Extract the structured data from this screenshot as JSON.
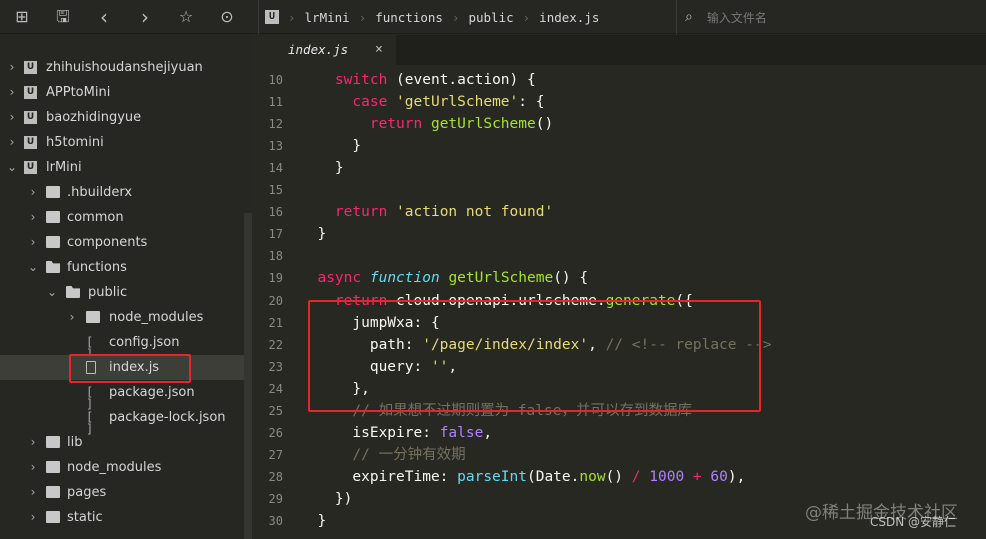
{
  "toolbar": {
    "icons": [
      "new-file-icon",
      "save-icon",
      "back-icon",
      "forward-icon",
      "star-icon",
      "run-icon"
    ]
  },
  "breadcrumb": [
    "lrMini",
    "functions",
    "public",
    "index.js"
  ],
  "search": {
    "placeholder": "输入文件名"
  },
  "tab": {
    "label": "index.js",
    "close": "×"
  },
  "sidebar": {
    "items": [
      {
        "label": "zhihuishoudanshejiyuan",
        "level": 0,
        "type": "project",
        "arrow": "›"
      },
      {
        "label": "APPtoMini",
        "level": 0,
        "type": "project",
        "arrow": "›"
      },
      {
        "label": "baozhidingyue",
        "level": 0,
        "type": "project",
        "arrow": "›"
      },
      {
        "label": "h5tomini",
        "level": 0,
        "type": "project",
        "arrow": "›"
      },
      {
        "label": "lrMini",
        "level": 0,
        "type": "project",
        "arrow": "⌄"
      },
      {
        "label": ".hbuilderx",
        "level": 1,
        "type": "folder",
        "arrow": "›"
      },
      {
        "label": "common",
        "level": 1,
        "type": "folder",
        "arrow": "›"
      },
      {
        "label": "components",
        "level": 1,
        "type": "folder",
        "arrow": "›"
      },
      {
        "label": "functions",
        "level": 1,
        "type": "folder-open",
        "arrow": "⌄"
      },
      {
        "label": "public",
        "level": 2,
        "type": "folder-open",
        "arrow": "⌄"
      },
      {
        "label": "node_modules",
        "level": 3,
        "type": "folder",
        "arrow": "›"
      },
      {
        "label": "config.json",
        "level": 3,
        "type": "json"
      },
      {
        "label": "index.js",
        "level": 3,
        "type": "file",
        "selected": true
      },
      {
        "label": "package.json",
        "level": 3,
        "type": "json"
      },
      {
        "label": "package-lock.json",
        "level": 3,
        "type": "json"
      },
      {
        "label": "lib",
        "level": 1,
        "type": "folder",
        "arrow": "›"
      },
      {
        "label": "node_modules",
        "level": 1,
        "type": "folder",
        "arrow": "›"
      },
      {
        "label": "pages",
        "level": 1,
        "type": "folder",
        "arrow": "›"
      },
      {
        "label": "static",
        "level": 1,
        "type": "folder",
        "arrow": "›"
      }
    ]
  },
  "code": [
    {
      "n": "10",
      "t": [
        [
          "    ",
          "p"
        ],
        [
          "switch",
          "k"
        ],
        [
          " (event.action) {",
          "p"
        ]
      ]
    },
    {
      "n": "11",
      "t": [
        [
          "      ",
          "p"
        ],
        [
          "case",
          "k"
        ],
        [
          " ",
          "p"
        ],
        [
          "'getUrlScheme'",
          "s"
        ],
        [
          ": {",
          "p"
        ]
      ]
    },
    {
      "n": "12",
      "t": [
        [
          "        ",
          "p"
        ],
        [
          "return",
          "k"
        ],
        [
          " ",
          "p"
        ],
        [
          "getUrlScheme",
          "f"
        ],
        [
          "()",
          "p"
        ]
      ]
    },
    {
      "n": "13",
      "t": [
        [
          "      }",
          "p"
        ]
      ]
    },
    {
      "n": "14",
      "t": [
        [
          "    }",
          "p"
        ]
      ]
    },
    {
      "n": "15",
      "t": []
    },
    {
      "n": "16",
      "t": [
        [
          "    ",
          "p"
        ],
        [
          "return",
          "k"
        ],
        [
          " ",
          "p"
        ],
        [
          "'action not found'",
          "s"
        ]
      ]
    },
    {
      "n": "17",
      "t": [
        [
          "  }",
          "p"
        ]
      ]
    },
    {
      "n": "18",
      "t": []
    },
    {
      "n": "19",
      "t": [
        [
          "  ",
          "p"
        ],
        [
          "async",
          "k"
        ],
        [
          " ",
          "p"
        ],
        [
          "function",
          "i"
        ],
        [
          " ",
          "p"
        ],
        [
          "getUrlScheme",
          "f"
        ],
        [
          "() {",
          "p"
        ]
      ]
    },
    {
      "n": "20",
      "t": [
        [
          "    ",
          "p"
        ],
        [
          "return",
          "k"
        ],
        [
          " cloud.openapi.urlscheme.",
          "p"
        ],
        [
          "generate",
          "f"
        ],
        [
          "({",
          "p"
        ]
      ]
    },
    {
      "n": "21",
      "t": [
        [
          "      jumpWxa: {",
          "p"
        ]
      ]
    },
    {
      "n": "22",
      "t": [
        [
          "        path: ",
          "p"
        ],
        [
          "'/page/index/index'",
          "s"
        ],
        [
          ", ",
          "p"
        ],
        [
          "// <!-- replace -->",
          "c"
        ]
      ]
    },
    {
      "n": "23",
      "t": [
        [
          "        query: ",
          "p"
        ],
        [
          "''",
          "s"
        ],
        [
          ",",
          "p"
        ]
      ]
    },
    {
      "n": "24",
      "t": [
        [
          "      },",
          "p"
        ]
      ]
    },
    {
      "n": "25",
      "t": [
        [
          "      ",
          "p"
        ],
        [
          "// 如果想不过期则置为 false，并可以存到数据库",
          "c"
        ]
      ]
    },
    {
      "n": "26",
      "t": [
        [
          "      isExpire: ",
          "p"
        ],
        [
          "false",
          "n"
        ],
        [
          ",",
          "p"
        ]
      ]
    },
    {
      "n": "27",
      "t": [
        [
          "      ",
          "p"
        ],
        [
          "// 一分钟有效期",
          "c"
        ]
      ]
    },
    {
      "n": "28",
      "t": [
        [
          "      expireTime: ",
          "p"
        ],
        [
          "parseInt",
          "b"
        ],
        [
          "(Date.",
          "p"
        ],
        [
          "now",
          "f"
        ],
        [
          "() ",
          "p"
        ],
        [
          "/",
          "k"
        ],
        [
          " ",
          "p"
        ],
        [
          "1000",
          "n"
        ],
        [
          " ",
          "p"
        ],
        [
          "+",
          "k"
        ],
        [
          " ",
          "p"
        ],
        [
          "60",
          "n"
        ],
        [
          "),",
          "p"
        ]
      ]
    },
    {
      "n": "29",
      "t": [
        [
          "    })",
          "p"
        ]
      ]
    },
    {
      "n": "30",
      "t": [
        [
          "  }",
          "p"
        ]
      ]
    }
  ],
  "watermark": {
    "juejin": "@稀土掘金技术社区",
    "csdn": "CSDN @安静仁"
  },
  "colors": {
    "highlight": "#e8262a",
    "background": "#272822",
    "keyword": "#f92672",
    "string": "#e6db74",
    "function": "#a6e22e",
    "number": "#ae81ff",
    "comment": "#75715e"
  }
}
